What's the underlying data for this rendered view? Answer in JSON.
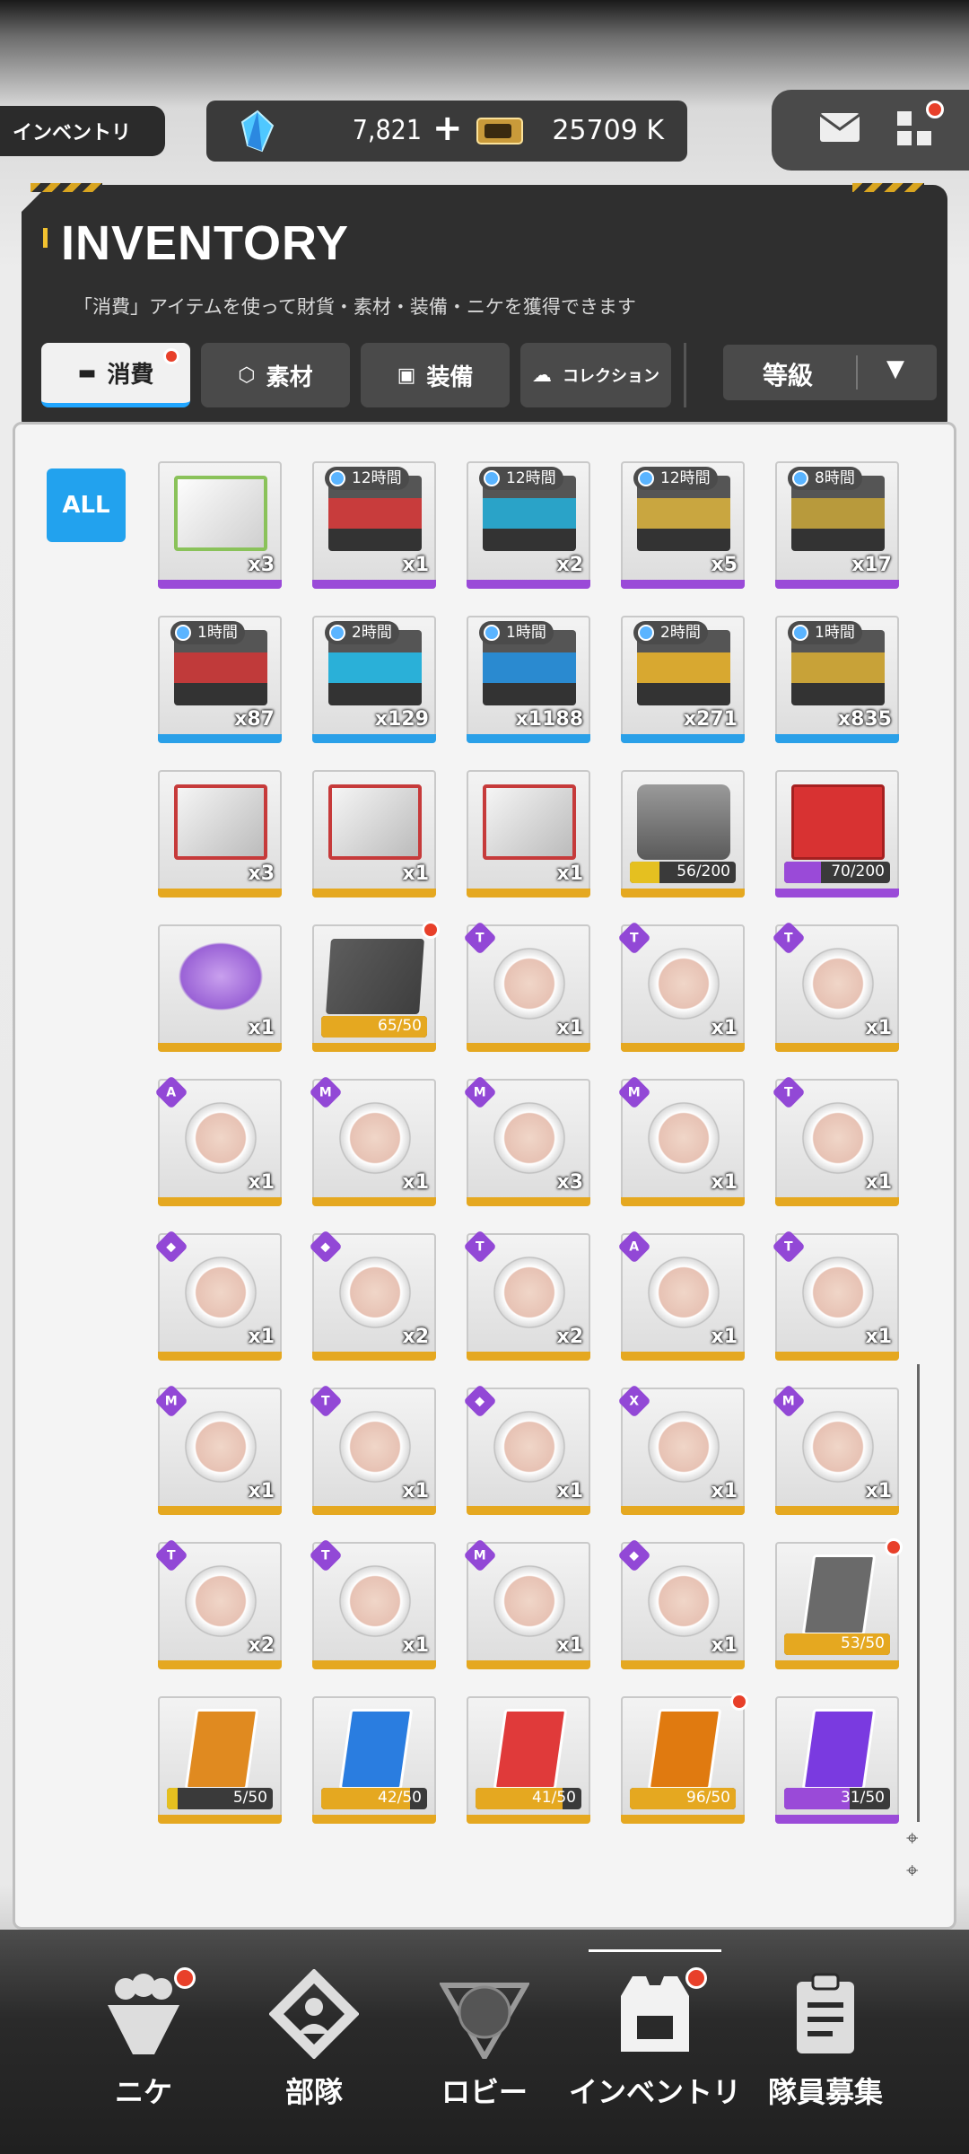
{
  "header_bar": {
    "location": "インベントリ",
    "gems": "7,821",
    "gems_plus": "+",
    "credits": "25709 K"
  },
  "inventory": {
    "title": "INVENTORY",
    "subtitle": "「消費」アイテムを使って財貨・素材・装備・ニケを獲得できます",
    "tabs": [
      {
        "label": "消費",
        "icon": "consumable-icon",
        "active": true
      },
      {
        "label": "素材",
        "icon": "material-icon",
        "active": false
      },
      {
        "label": "装備",
        "icon": "equipment-icon",
        "active": false
      },
      {
        "label": "コレクション",
        "icon": "collection-icon",
        "active": false
      }
    ],
    "sort": {
      "label": "等級",
      "arrow": "▼"
    },
    "filter_all": "ALL"
  },
  "items": [
    {
      "kind": "greenbox",
      "qty": "x3",
      "rarity": "purple"
    },
    {
      "kind": "case",
      "timer": "12時間",
      "qty": "x1",
      "rarity": "purple",
      "color": "#c83c3c"
    },
    {
      "kind": "case",
      "timer": "12時間",
      "qty": "x2",
      "rarity": "purple",
      "color": "#2aa3c8"
    },
    {
      "kind": "case",
      "timer": "12時間",
      "qty": "x5",
      "rarity": "purple",
      "color": "#c9a640"
    },
    {
      "kind": "case",
      "timer": "8時間",
      "qty": "x17",
      "rarity": "purple",
      "color": "#b89a3c"
    },
    {
      "kind": "case",
      "timer": "1時間",
      "qty": "x87",
      "rarity": "blue",
      "color": "#c03a3a"
    },
    {
      "kind": "case",
      "timer": "2時間",
      "qty": "x129",
      "rarity": "blue",
      "color": "#2ab0d8"
    },
    {
      "kind": "case",
      "timer": "1時間",
      "qty": "x1188",
      "rarity": "blue",
      "color": "#2a8ad0"
    },
    {
      "kind": "case",
      "timer": "2時間",
      "qty": "x271",
      "rarity": "blue",
      "color": "#d8a830"
    },
    {
      "kind": "case",
      "timer": "1時間",
      "qty": "x835",
      "rarity": "blue",
      "color": "#c8a238"
    },
    {
      "kind": "box",
      "qty": "x3",
      "rarity": "gold"
    },
    {
      "kind": "box",
      "qty": "x1",
      "rarity": "gold"
    },
    {
      "kind": "box",
      "qty": "x1",
      "rarity": "gold"
    },
    {
      "kind": "crate",
      "progress": "56/200",
      "fill": 0.28,
      "rarity": "gold",
      "pcolor": "#e5c020"
    },
    {
      "kind": "lucky",
      "progress": "70/200",
      "fill": 0.35,
      "rarity": "purple",
      "pcolor": "#9a4ad8"
    },
    {
      "kind": "cake",
      "qty": "x1",
      "rarity": "gold"
    },
    {
      "kind": "doc",
      "progress": "65/50",
      "fill": 1,
      "rarity": "gold",
      "pcolor": "#e5a820",
      "dot": true
    },
    {
      "kind": "hex",
      "badge": "T",
      "qty": "x1",
      "rarity": "gold"
    },
    {
      "kind": "hex",
      "badge": "T",
      "qty": "x1",
      "rarity": "gold"
    },
    {
      "kind": "hex",
      "badge": "T",
      "qty": "x1",
      "rarity": "gold"
    },
    {
      "kind": "hex",
      "badge": "A",
      "qty": "x1",
      "rarity": "gold"
    },
    {
      "kind": "hex",
      "badge": "M",
      "qty": "x1",
      "rarity": "gold"
    },
    {
      "kind": "hex",
      "badge": "M",
      "qty": "x3",
      "rarity": "gold"
    },
    {
      "kind": "hex",
      "badge": "M",
      "qty": "x1",
      "rarity": "gold"
    },
    {
      "kind": "hex",
      "badge": "T",
      "qty": "x1",
      "rarity": "gold"
    },
    {
      "kind": "hex",
      "badge": "◆",
      "qty": "x1",
      "rarity": "gold"
    },
    {
      "kind": "hex",
      "badge": "◆",
      "qty": "x2",
      "rarity": "gold"
    },
    {
      "kind": "hex",
      "badge": "T",
      "qty": "x2",
      "rarity": "gold"
    },
    {
      "kind": "hex",
      "badge": "A",
      "qty": "x1",
      "rarity": "gold"
    },
    {
      "kind": "hex",
      "badge": "T",
      "qty": "x1",
      "rarity": "gold"
    },
    {
      "kind": "hex",
      "badge": "M",
      "qty": "x1",
      "rarity": "gold"
    },
    {
      "kind": "hex",
      "badge": "T",
      "qty": "x1",
      "rarity": "gold"
    },
    {
      "kind": "hex",
      "badge": "◆",
      "qty": "x1",
      "rarity": "gold"
    },
    {
      "kind": "hex",
      "badge": "X",
      "qty": "x1",
      "rarity": "gold"
    },
    {
      "kind": "hex",
      "badge": "M",
      "qty": "x1",
      "rarity": "gold"
    },
    {
      "kind": "hex",
      "badge": "T",
      "qty": "x2",
      "rarity": "gold"
    },
    {
      "kind": "hex",
      "badge": "T",
      "qty": "x1",
      "rarity": "gold"
    },
    {
      "kind": "hex",
      "badge": "M",
      "qty": "x1",
      "rarity": "gold"
    },
    {
      "kind": "hex",
      "badge": "◆",
      "qty": "x1",
      "rarity": "gold"
    },
    {
      "kind": "frag",
      "progress": "53/50",
      "fill": 1,
      "rarity": "gold",
      "pcolor": "#e5a820",
      "color": "#6a6a6a",
      "dot": true
    },
    {
      "kind": "frag",
      "progress": "5/50",
      "fill": 0.1,
      "rarity": "gold",
      "pcolor": "#e5c020",
      "color": "#e08a20"
    },
    {
      "kind": "frag",
      "progress": "42/50",
      "fill": 0.84,
      "rarity": "gold",
      "pcolor": "#e5a820",
      "color": "#2a7de0"
    },
    {
      "kind": "frag",
      "progress": "41/50",
      "fill": 0.82,
      "rarity": "gold",
      "pcolor": "#e5a820",
      "color": "#e03a3a"
    },
    {
      "kind": "frag",
      "progress": "96/50",
      "fill": 1,
      "rarity": "gold",
      "pcolor": "#e5a820",
      "color": "#e07a10",
      "dot": true
    },
    {
      "kind": "frag",
      "progress": "31/50",
      "fill": 0.62,
      "rarity": "purple",
      "pcolor": "#9a4ad8",
      "color": "#7a3ae0"
    }
  ],
  "rarity_colors": {
    "purple": "#9a4ad8",
    "blue": "#2aa0e8",
    "gold": "#e5a820"
  },
  "nav": [
    {
      "label": "ニケ",
      "icon": "nikke-icon",
      "dot": true
    },
    {
      "label": "部隊",
      "icon": "squad-icon",
      "dot": false
    },
    {
      "label": "ロビー",
      "icon": "lobby-icon",
      "dot": false
    },
    {
      "label": "インベントリ",
      "icon": "inventory-icon",
      "dot": true,
      "active": true
    },
    {
      "label": "隊員募集",
      "icon": "recruit-icon",
      "dot": false
    }
  ]
}
